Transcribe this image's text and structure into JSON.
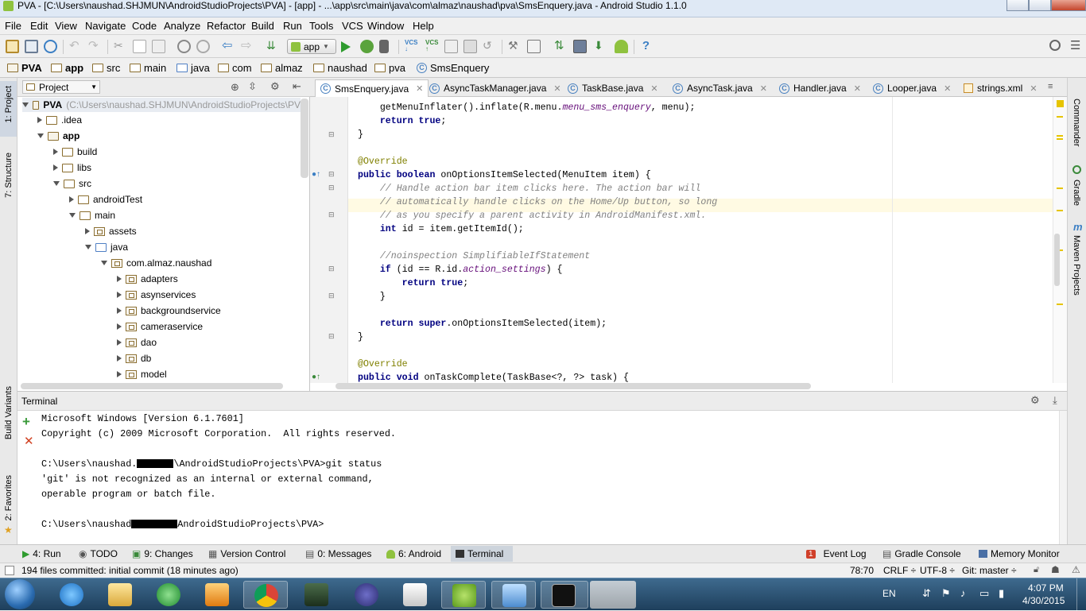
{
  "window": {
    "title": "PVA - [C:\\Users\\naushad.SHJMUN\\AndroidStudioProjects\\PVA] - [app] - ...\\app\\src\\main\\java\\com\\almaz\\naushad\\pva\\SmsEnquery.java - Android Studio 1.1.0"
  },
  "menu": [
    "File",
    "Edit",
    "View",
    "Navigate",
    "Code",
    "Analyze",
    "Refactor",
    "Build",
    "Run",
    "Tools",
    "VCS",
    "Window",
    "Help"
  ],
  "toolbar": {
    "run_config": "app"
  },
  "breadcrumb": [
    "PVA",
    "app",
    "src",
    "main",
    "java",
    "com",
    "almaz",
    "naushad",
    "pva",
    "SmsEnquery"
  ],
  "left_strip": {
    "project": "1: Project",
    "structure": "7: Structure",
    "build_variants": "Build Variants",
    "favorites": "2: Favorites"
  },
  "right_strip": {
    "commander": "Commander",
    "gradle": "Gradle",
    "maven": "Maven Projects"
  },
  "project_panel": {
    "view_label": "Project",
    "root_name": "PVA",
    "root_path": "(C:\\Users\\naushad.SHJMUN\\AndroidStudioProjects\\PV",
    "tree": [
      ".idea",
      "app",
      "build",
      "libs",
      "src",
      "androidTest",
      "main",
      "assets",
      "java",
      "com.almaz.naushad",
      "adapters",
      "asynservices",
      "backgroundservice",
      "cameraservice",
      "dao",
      "db",
      "model"
    ]
  },
  "tabs": [
    "SmsEnquery.java",
    "AsyncTaskManager.java",
    "TaskBase.java",
    "AsyncTask.java",
    "Handler.java",
    "Looper.java",
    "strings.xml"
  ],
  "code": {
    "l1a": "    getMenuInflater().inflate(R.menu.",
    "l1b": "menu_sms_enquery",
    "l1c": ", menu);",
    "l2a": "    ",
    "l2b": "return true",
    "l2c": ";",
    "l3": "}",
    "l5": "@Override",
    "l6a": "public boolean ",
    "l6b": "onOptionsItemSelected(MenuItem item) {",
    "l7": "    // Handle action bar item clicks here. The action bar will",
    "l8": "    // automatically handle clicks on the Home/Up button, so long",
    "l9": "    // as you specify a parent activity in AndroidManifest.xml.",
    "l10a": "    ",
    "l10b": "int ",
    "l10c": "id = item.getItemId();",
    "l12": "    //noinspection SimplifiableIfStatement",
    "l13a": "    ",
    "l13b": "if ",
    "l13c": "(id == R.id.",
    "l13d": "action_settings",
    "l13e": ") {",
    "l14a": "        ",
    "l14b": "return true",
    "l14c": ";",
    "l15": "    }",
    "l17a": "    ",
    "l17b": "return super",
    "l17c": ".onOptionsItemSelected(item);",
    "l18": "}",
    "l20": "@Override",
    "l21a": "public void ",
    "l21b": "onTaskComplete(TaskBase<?, ?> task) {"
  },
  "terminal": {
    "title": "Terminal",
    "line1": "Microsoft Windows [Version 6.1.7601]",
    "line2": "Copyright (c) 2009 Microsoft Corporation.  All rights reserved.",
    "line3a": "C:\\Users\\naushad.",
    "line3b": "\\AndroidStudioProjects\\PVA>git status",
    "line4": "'git' is not recognized as an internal or external command,",
    "line5": "operable program or batch file.",
    "line6a": "C:\\Users\\naushad",
    "line6b": "AndroidStudioProjects\\PVA>"
  },
  "bottom_tools": {
    "run": "4: Run",
    "todo": "TODO",
    "changes": "9: Changes",
    "vcs": "Version Control",
    "messages": "0: Messages",
    "android": "6: Android",
    "terminal": "Terminal",
    "event_log_count": "1",
    "event_log": "Event Log",
    "gradle_console": "Gradle Console",
    "memory": "Memory Monitor"
  },
  "status": {
    "message": "194 files committed: initial commit (18 minutes ago)",
    "position": "78:70",
    "line_sep": "CRLF ÷",
    "encoding": "UTF-8 ÷",
    "git": "Git: master ÷"
  },
  "taskbar": {
    "lang": "EN",
    "time": "4:07 PM",
    "date": "4/30/2015"
  },
  "colors": {
    "keyword": "#000080",
    "annotation": "#808000",
    "comment": "#808080",
    "field": "#660e7a",
    "taskbar": "#2b5170"
  }
}
